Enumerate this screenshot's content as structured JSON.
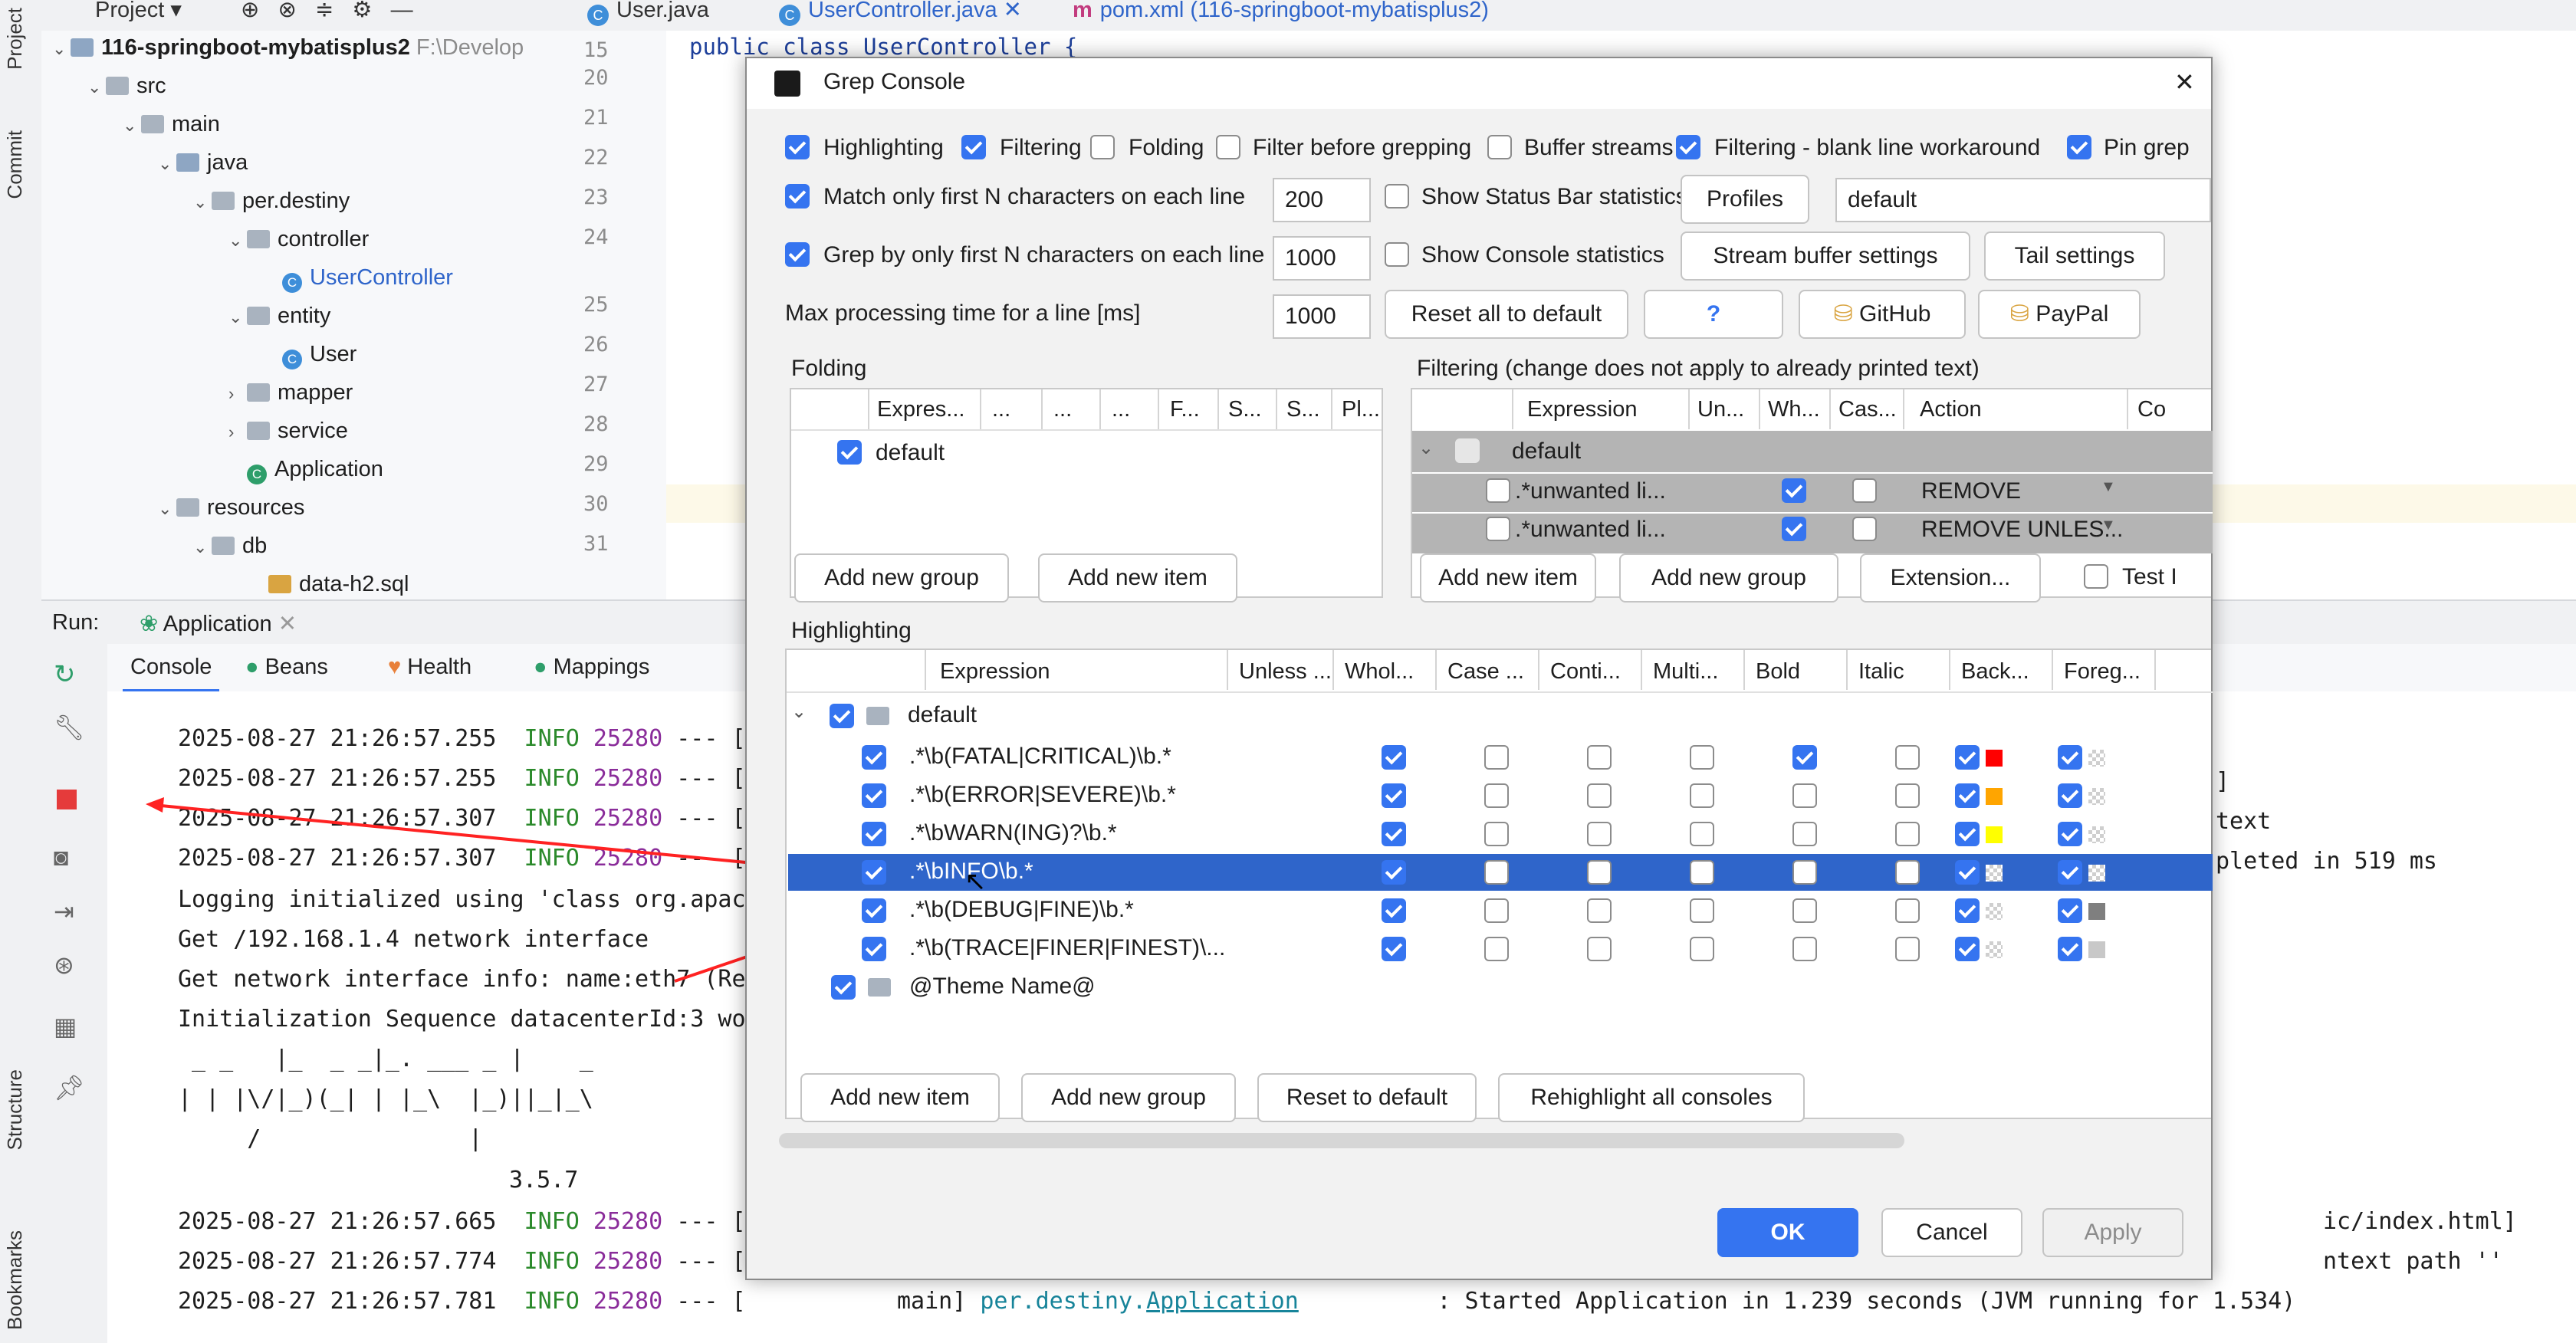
{
  "leftbar": {
    "project": "Project",
    "commit": "Commit",
    "structure": "Structure",
    "bookmarks": "Bookmarks"
  },
  "tabs": {
    "project_dropdown": "Project",
    "tab1": "User.java",
    "tab2": "UserController.java",
    "tab3": "pom.xml (116-springboot-mybatisplus2)"
  },
  "tree": {
    "root": "116-springboot-mybatisplus2",
    "root_path": "F:\\Develop",
    "items": [
      "src",
      "main",
      "java",
      "per.destiny",
      "controller",
      "UserController",
      "entity",
      "User",
      "mapper",
      "service",
      "Application",
      "resources",
      "db",
      "data-h2.sql"
    ]
  },
  "gutter": {
    "lines": [
      "15",
      "20",
      "21",
      "22",
      "23",
      "24",
      "25",
      "26",
      "27",
      "28",
      "29",
      "30",
      "31"
    ]
  },
  "editor": {
    "line15": "public class UserController {"
  },
  "run": {
    "label": "Run:",
    "config": "Application"
  },
  "run_tabs": [
    "Console",
    "Beans",
    "Health",
    "Mappings"
  ],
  "console": {
    "lines": [
      {
        "ts": "2025-08-27 21:26:57.255",
        "lvl": "INFO",
        "pid": "25280",
        "sep": "--- ["
      },
      {
        "ts": "2025-08-27 21:26:57.255",
        "lvl": "INFO",
        "pid": "25280",
        "sep": "--- ["
      },
      {
        "ts": "2025-08-27 21:26:57.307",
        "lvl": "INFO",
        "pid": "25280",
        "sep": "--- ["
      },
      {
        "ts": "2025-08-27 21:26:57.307",
        "lvl": "INFO",
        "pid": "25280",
        "sep": "--- ["
      }
    ],
    "logging": "Logging initialized using 'class org.apac",
    "get_ip": "Get /192.168.1.4 network interface",
    "get_info": "Get network interface info: name:eth7 (Re",
    "init": "Initialization Sequence datacenterId:3 wo",
    "banner1": " _ _   |_  _ _|_. ___ _ |    _",
    "banner2": "| | |\\/|_)(_| | |_\\  |_)||_|_\\",
    "banner3": "     /               |",
    "version": "3.5.7",
    "lines2": [
      {
        "ts": "2025-08-27 21:26:57.665",
        "lvl": "INFO",
        "pid": "25280",
        "sep": "--- ["
      },
      {
        "ts": "2025-08-27 21:26:57.774",
        "lvl": "INFO",
        "pid": "25280",
        "sep": "--- ["
      },
      {
        "ts": "2025-08-27 21:26:57.781",
        "lvl": "INFO",
        "pid": "25280",
        "sep": "--- ["
      }
    ],
    "last_main": "main]",
    "last_pkg": "per.destiny.",
    "last_cls": "Application",
    "last_msg": ": Started Application in 1.239 seconds (JVM running for 1.534)",
    "right_frag1": "]",
    "right_frag2": "text",
    "right_frag3": "pleted in 519 ms",
    "right_frag4": "ic/index.html]",
    "right_frag5": "ntext path ''"
  },
  "dialog": {
    "title": "Grep Console",
    "close": "✕",
    "opts": {
      "highlighting": "Highlighting",
      "filtering": "Filtering",
      "folding": "Folding",
      "filter_before": "Filter before grepping",
      "buffer_streams": "Buffer streams",
      "blank_line": "Filtering - blank line workaround",
      "pin": "Pin grep",
      "match_first_n": "Match only first N characters on each line",
      "match_first_n_val": "200",
      "show_status": "Show Status Bar statistics",
      "profiles": "Profiles",
      "profile_val": "default",
      "grep_first_n": "Grep by only first N characters on each line",
      "grep_first_n_val": "1000",
      "show_console": "Show Console statistics",
      "stream_buffer": "Stream buffer settings",
      "tail": "Tail settings",
      "max_time": "Max processing time for a line [ms]",
      "max_time_val": "1000",
      "reset_all": "Reset all to default",
      "help": "?",
      "github": "GitHub",
      "paypal": "PayPal"
    },
    "folding": {
      "title": "Folding",
      "headers": [
        "Expres...",
        "...",
        "...",
        "...",
        "F...",
        "S...",
        "S...",
        "Pl..."
      ],
      "group": "default",
      "add_group": "Add new group",
      "add_item": "Add new item"
    },
    "filtering": {
      "title": "Filtering (change does not apply to already printed text)",
      "headers": [
        "Expression",
        "Un...",
        "Wh...",
        "Cas...",
        "Action",
        "Co"
      ],
      "group": "default",
      "rows": [
        {
          "expr": ".*unwanted li...",
          "action": "REMOVE"
        },
        {
          "expr": ".*unwanted li...",
          "action": "REMOVE UNLES..."
        }
      ],
      "add_item": "Add new item",
      "add_group": "Add new group",
      "extension": "Extension...",
      "test": "Test I"
    },
    "highlighting": {
      "title": "Highlighting",
      "headers": [
        "Expression",
        "Unless ...",
        "Whol...",
        "Case ...",
        "Conti...",
        "Multi...",
        "Bold",
        "Italic",
        "Back...",
        "Foreg..."
      ],
      "group": "default",
      "rows": [
        {
          "expr": ".*\\b(FATAL|CRITICAL)\\b.*",
          "bold": true,
          "bg": "#ff0000",
          "fg": "checker"
        },
        {
          "expr": ".*\\b(ERROR|SEVERE)\\b.*",
          "bold": false,
          "bg": "#ffa500",
          "fg": "checker"
        },
        {
          "expr": ".*\\bWARN(ING)?\\b.*",
          "bold": false,
          "bg": "#ffff00",
          "fg": "checker"
        },
        {
          "expr": ".*\\bINFO\\b.*",
          "bold": false,
          "bg": "checker",
          "fg": "checker"
        },
        {
          "expr": ".*\\b(DEBUG|FINE)\\b.*",
          "bold": false,
          "bg": "checker",
          "fg": "#7f7f7f"
        },
        {
          "expr": ".*\\b(TRACE|FINER|FINEST)\\...",
          "bold": false,
          "bg": "checker",
          "fg": "#c8c8c8"
        }
      ],
      "theme": "@Theme Name@",
      "add_item": "Add new item",
      "add_group": "Add new group",
      "reset": "Reset to default",
      "rehighlight": "Rehighlight all consoles"
    },
    "footer": {
      "ok": "OK",
      "cancel": "Cancel",
      "apply": "Apply"
    }
  },
  "colors": {
    "accent": "#3574f0",
    "selection": "#2f65ca",
    "annotation": "#ff2222"
  }
}
